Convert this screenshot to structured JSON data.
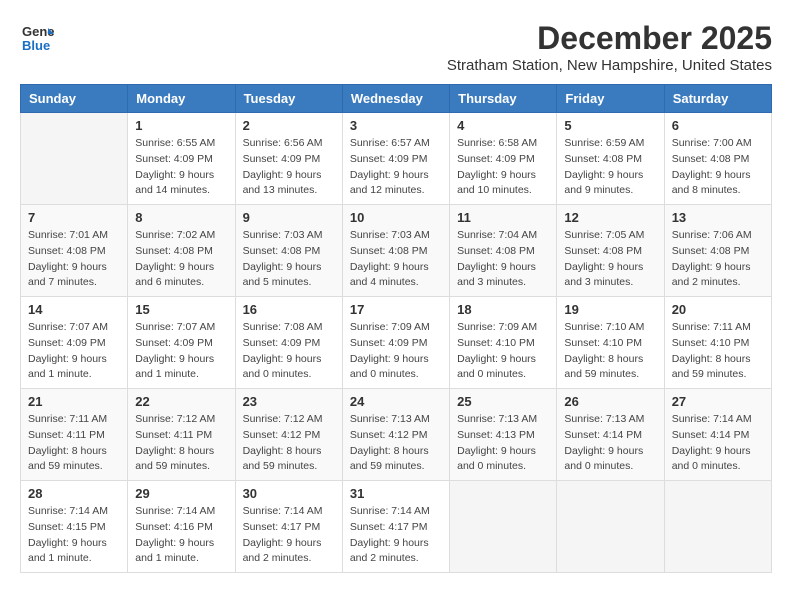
{
  "header": {
    "logo_general": "General",
    "logo_blue": "Blue",
    "title": "December 2025",
    "location": "Stratham Station, New Hampshire, United States"
  },
  "calendar": {
    "days_of_week": [
      "Sunday",
      "Monday",
      "Tuesday",
      "Wednesday",
      "Thursday",
      "Friday",
      "Saturday"
    ],
    "weeks": [
      [
        {
          "day": "",
          "info": ""
        },
        {
          "day": "1",
          "info": "Sunrise: 6:55 AM\nSunset: 4:09 PM\nDaylight: 9 hours\nand 14 minutes."
        },
        {
          "day": "2",
          "info": "Sunrise: 6:56 AM\nSunset: 4:09 PM\nDaylight: 9 hours\nand 13 minutes."
        },
        {
          "day": "3",
          "info": "Sunrise: 6:57 AM\nSunset: 4:09 PM\nDaylight: 9 hours\nand 12 minutes."
        },
        {
          "day": "4",
          "info": "Sunrise: 6:58 AM\nSunset: 4:09 PM\nDaylight: 9 hours\nand 10 minutes."
        },
        {
          "day": "5",
          "info": "Sunrise: 6:59 AM\nSunset: 4:08 PM\nDaylight: 9 hours\nand 9 minutes."
        },
        {
          "day": "6",
          "info": "Sunrise: 7:00 AM\nSunset: 4:08 PM\nDaylight: 9 hours\nand 8 minutes."
        }
      ],
      [
        {
          "day": "7",
          "info": "Sunrise: 7:01 AM\nSunset: 4:08 PM\nDaylight: 9 hours\nand 7 minutes."
        },
        {
          "day": "8",
          "info": "Sunrise: 7:02 AM\nSunset: 4:08 PM\nDaylight: 9 hours\nand 6 minutes."
        },
        {
          "day": "9",
          "info": "Sunrise: 7:03 AM\nSunset: 4:08 PM\nDaylight: 9 hours\nand 5 minutes."
        },
        {
          "day": "10",
          "info": "Sunrise: 7:03 AM\nSunset: 4:08 PM\nDaylight: 9 hours\nand 4 minutes."
        },
        {
          "day": "11",
          "info": "Sunrise: 7:04 AM\nSunset: 4:08 PM\nDaylight: 9 hours\nand 3 minutes."
        },
        {
          "day": "12",
          "info": "Sunrise: 7:05 AM\nSunset: 4:08 PM\nDaylight: 9 hours\nand 3 minutes."
        },
        {
          "day": "13",
          "info": "Sunrise: 7:06 AM\nSunset: 4:08 PM\nDaylight: 9 hours\nand 2 minutes."
        }
      ],
      [
        {
          "day": "14",
          "info": "Sunrise: 7:07 AM\nSunset: 4:09 PM\nDaylight: 9 hours\nand 1 minute."
        },
        {
          "day": "15",
          "info": "Sunrise: 7:07 AM\nSunset: 4:09 PM\nDaylight: 9 hours\nand 1 minute."
        },
        {
          "day": "16",
          "info": "Sunrise: 7:08 AM\nSunset: 4:09 PM\nDaylight: 9 hours\nand 0 minutes."
        },
        {
          "day": "17",
          "info": "Sunrise: 7:09 AM\nSunset: 4:09 PM\nDaylight: 9 hours\nand 0 minutes."
        },
        {
          "day": "18",
          "info": "Sunrise: 7:09 AM\nSunset: 4:10 PM\nDaylight: 9 hours\nand 0 minutes."
        },
        {
          "day": "19",
          "info": "Sunrise: 7:10 AM\nSunset: 4:10 PM\nDaylight: 8 hours\nand 59 minutes."
        },
        {
          "day": "20",
          "info": "Sunrise: 7:11 AM\nSunset: 4:10 PM\nDaylight: 8 hours\nand 59 minutes."
        }
      ],
      [
        {
          "day": "21",
          "info": "Sunrise: 7:11 AM\nSunset: 4:11 PM\nDaylight: 8 hours\nand 59 minutes."
        },
        {
          "day": "22",
          "info": "Sunrise: 7:12 AM\nSunset: 4:11 PM\nDaylight: 8 hours\nand 59 minutes."
        },
        {
          "day": "23",
          "info": "Sunrise: 7:12 AM\nSunset: 4:12 PM\nDaylight: 8 hours\nand 59 minutes."
        },
        {
          "day": "24",
          "info": "Sunrise: 7:13 AM\nSunset: 4:12 PM\nDaylight: 8 hours\nand 59 minutes."
        },
        {
          "day": "25",
          "info": "Sunrise: 7:13 AM\nSunset: 4:13 PM\nDaylight: 9 hours\nand 0 minutes."
        },
        {
          "day": "26",
          "info": "Sunrise: 7:13 AM\nSunset: 4:14 PM\nDaylight: 9 hours\nand 0 minutes."
        },
        {
          "day": "27",
          "info": "Sunrise: 7:14 AM\nSunset: 4:14 PM\nDaylight: 9 hours\nand 0 minutes."
        }
      ],
      [
        {
          "day": "28",
          "info": "Sunrise: 7:14 AM\nSunset: 4:15 PM\nDaylight: 9 hours\nand 1 minute."
        },
        {
          "day": "29",
          "info": "Sunrise: 7:14 AM\nSunset: 4:16 PM\nDaylight: 9 hours\nand 1 minute."
        },
        {
          "day": "30",
          "info": "Sunrise: 7:14 AM\nSunset: 4:17 PM\nDaylight: 9 hours\nand 2 minutes."
        },
        {
          "day": "31",
          "info": "Sunrise: 7:14 AM\nSunset: 4:17 PM\nDaylight: 9 hours\nand 2 minutes."
        },
        {
          "day": "",
          "info": ""
        },
        {
          "day": "",
          "info": ""
        },
        {
          "day": "",
          "info": ""
        }
      ]
    ]
  }
}
